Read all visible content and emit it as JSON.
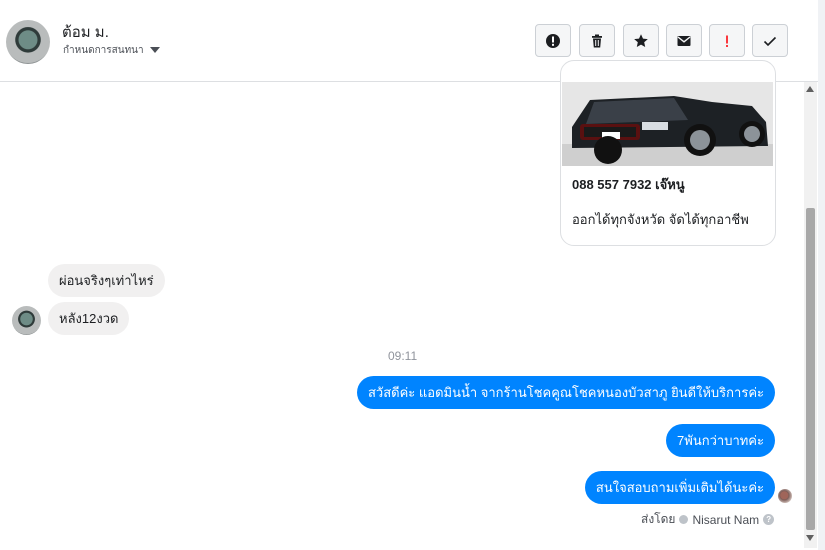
{
  "header": {
    "name": "ต้อม ม.",
    "subtitle": "กำหนดการสนทนา",
    "actions": [
      {
        "name": "alert-icon"
      },
      {
        "name": "trash-icon"
      },
      {
        "name": "star-icon"
      },
      {
        "name": "envelope-icon"
      },
      {
        "name": "exclamation-icon"
      },
      {
        "name": "check-icon"
      }
    ]
  },
  "card": {
    "title": "088 557 7932 เจ๊หนู",
    "description": "ออกได้ทุกจังหวัด จัดได้ทุกอาชีพ"
  },
  "messages": {
    "in1": "ผ่อนจริงๆเท่าไหร่",
    "in2": "หลัง12งวด",
    "time": "09:11",
    "out1": "สวัสดีค่ะ แอดมินน้ำ จากร้านโชคคูณโชคหนองบัวสาภู ยินดีให้บริการค่ะ",
    "out2": "7พันกว่าบาทค่ะ",
    "out3": "สนใจสอบถามเพิ่มเติมได้นะค่ะ"
  },
  "footer": {
    "sent_by_label": "ส่งโดย",
    "sender": "Nisarut Nam"
  },
  "colors": {
    "accent": "#0084ff",
    "incoming_bubble": "#f1f0f0",
    "danger": "#fa383e"
  }
}
